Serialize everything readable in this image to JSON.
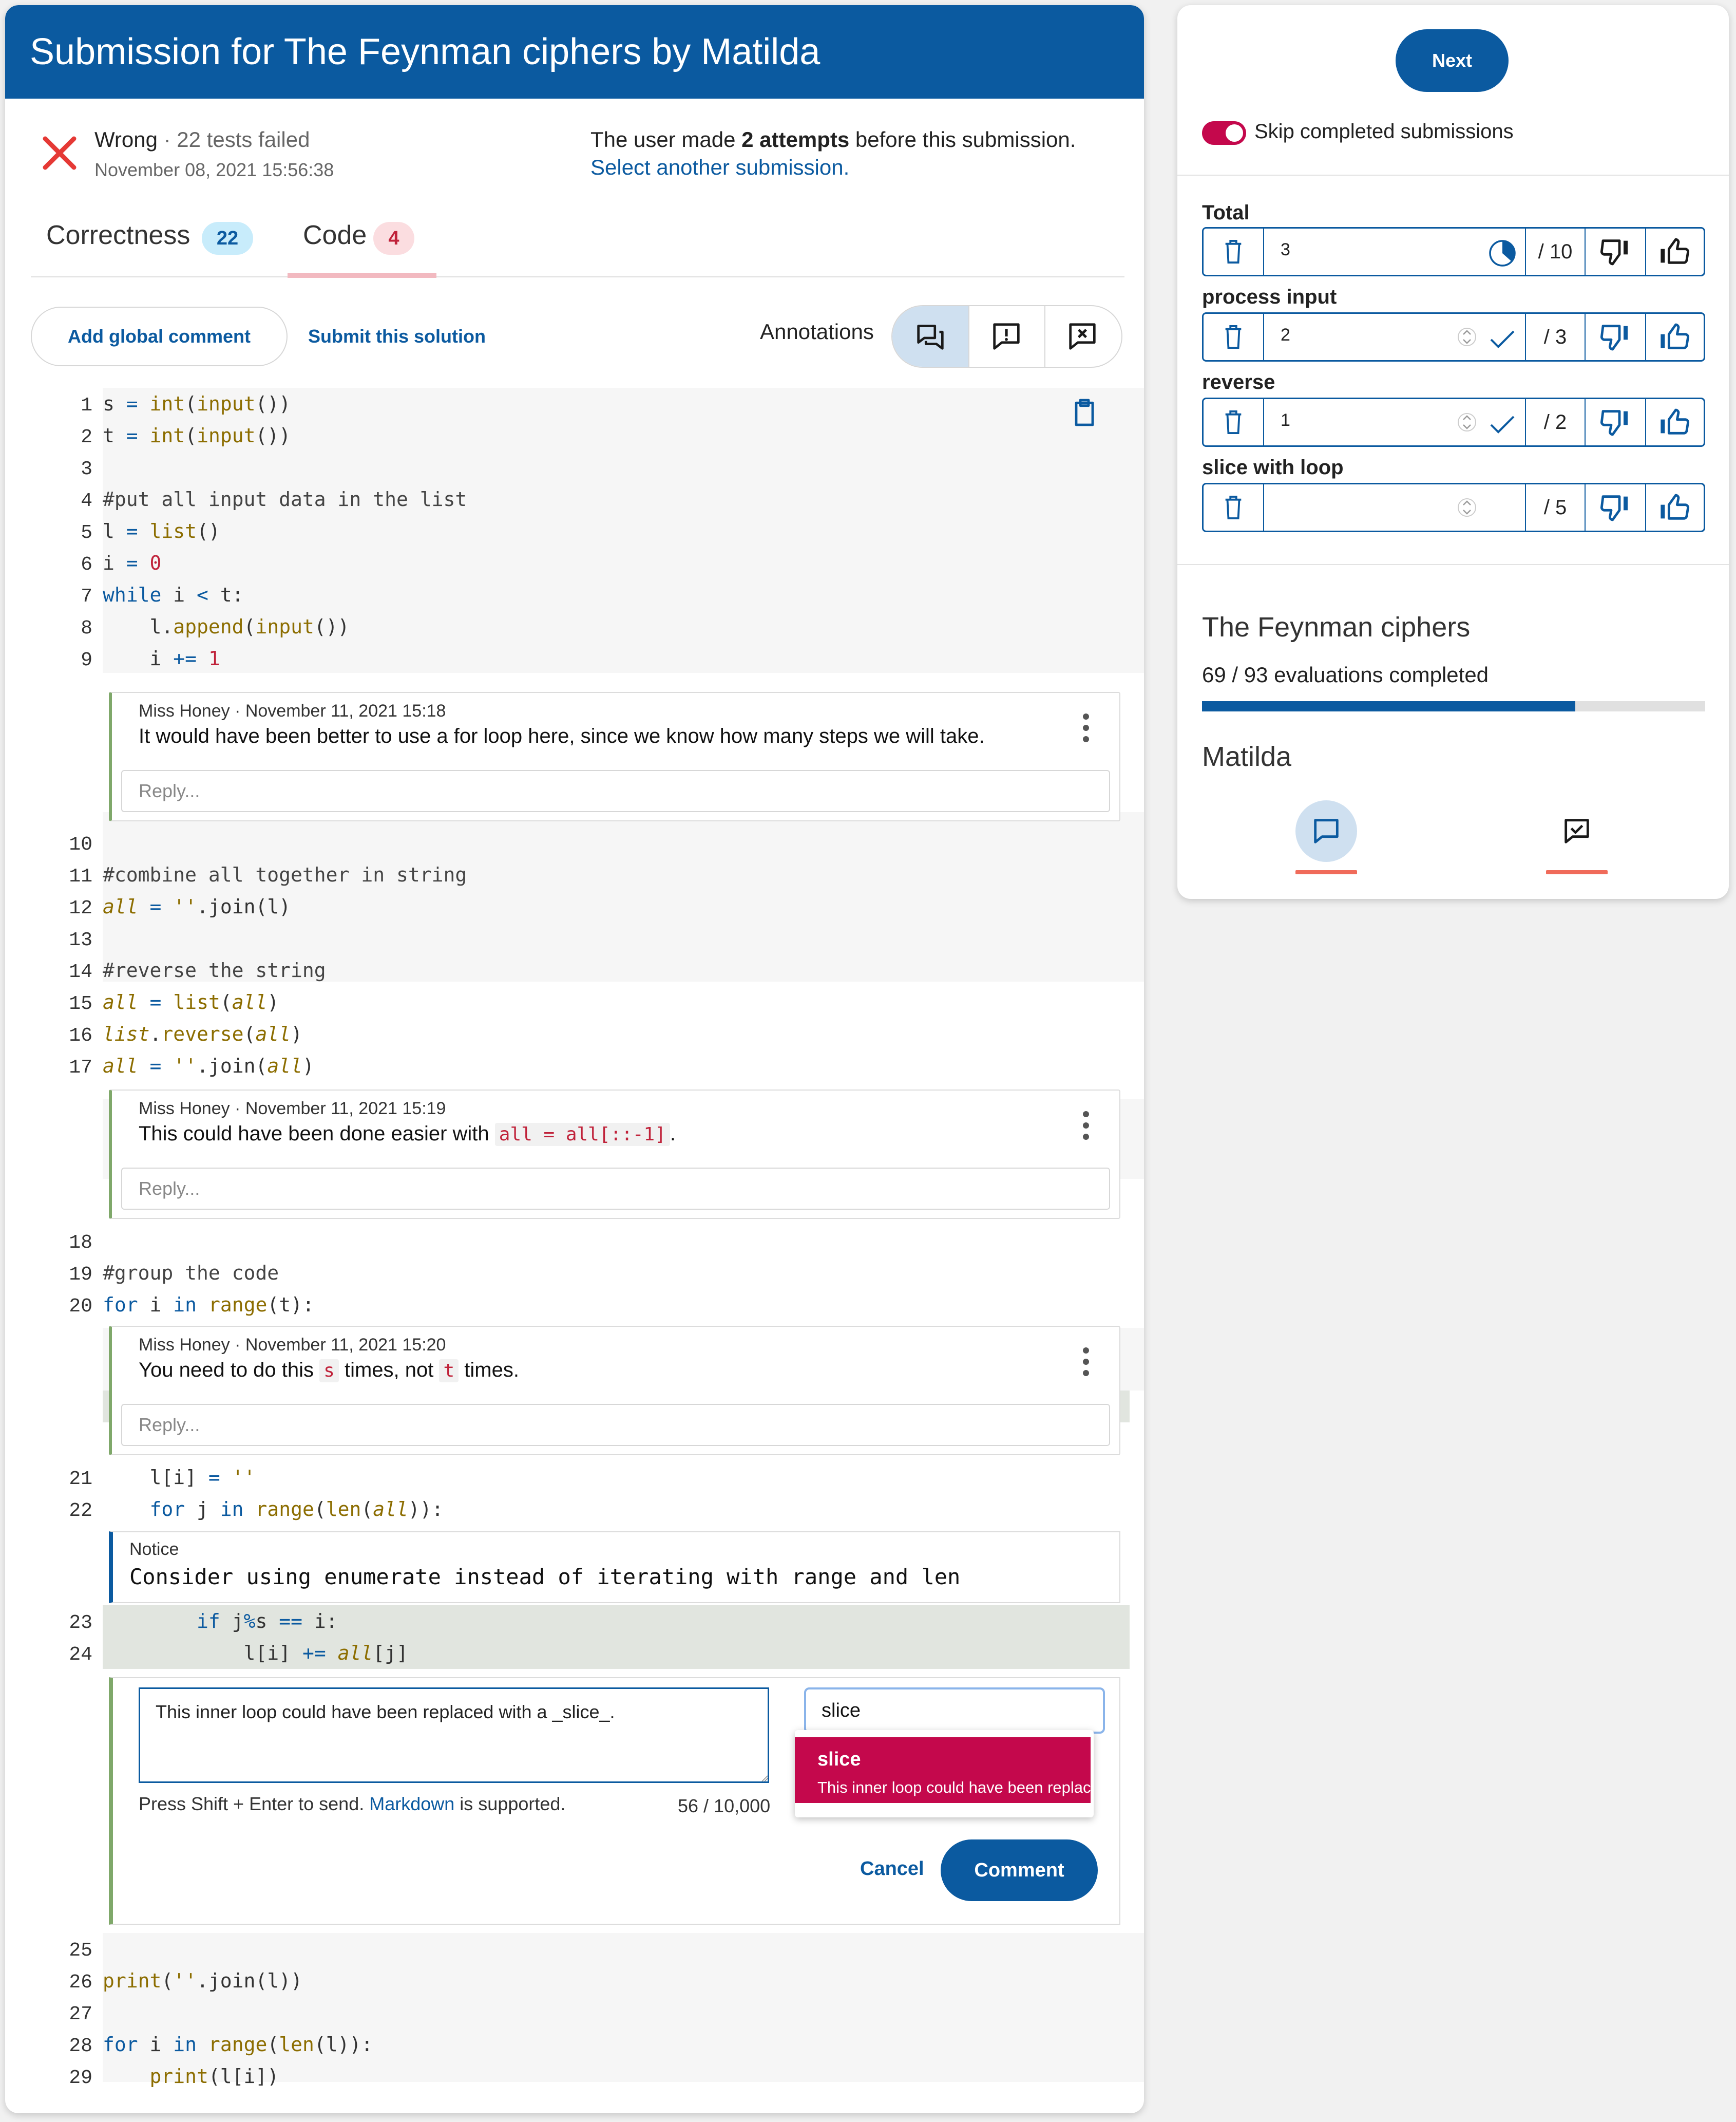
{
  "header": {
    "title": "Submission for The Feynman ciphers by Matilda"
  },
  "status": {
    "result": "Wrong",
    "separator": " · ",
    "tests": "22 tests failed",
    "date": "November 08, 2021 15:56:38",
    "attempts_prefix": "The user made ",
    "attempts_count": "2 attempts",
    "attempts_suffix": " before this submission.",
    "select_link": "Select another submission."
  },
  "tabs": [
    {
      "label": "Correctness",
      "badge": "22"
    },
    {
      "label": "Code",
      "badge": "4"
    }
  ],
  "toolbar": {
    "add_global": "Add global comment",
    "submit": "Submit this solution",
    "annotations_label": "Annotations"
  },
  "code": {
    "lines": [
      "s = int(input())",
      "t = int(input())",
      "",
      "#put all input data in the list",
      "l = list()",
      "i = 0",
      "while i < t:",
      "    l.append(input())",
      "    i += 1",
      "",
      "#combine all together in string",
      "all = ''.join(l)",
      "",
      "#reverse the string",
      "all = list(all)",
      "list.reverse(all)",
      "all = ''.join(all)",
      "",
      "#group the code",
      "for i in range(t):",
      "    l[i] = ''",
      "    for j in range(len(all)):",
      "        if j%s == i:",
      "            l[i] += all[j]",
      "",
      "print(''.join(l))",
      "",
      "for i in range(len(l)):",
      "    print(l[i])"
    ]
  },
  "comments": [
    {
      "meta": "Miss Honey · November 11, 2021 15:18",
      "text": "It would have been better to use a for loop here, since we know how many steps we will take.",
      "reply": "Reply..."
    },
    {
      "meta": "Miss Honey · November 11, 2021 15:19",
      "text_before": "This could have been done easier with ",
      "code": "all = all[::-1]",
      "text_after": ".",
      "reply": "Reply..."
    },
    {
      "meta": "Miss Honey · November 11, 2021 15:20",
      "text_1": "You need to do this ",
      "code_1": "s",
      "text_2": " times, not ",
      "code_2": "t",
      "text_3": " times.",
      "reply": "Reply..."
    }
  ],
  "notice": {
    "title": "Notice",
    "body": "Consider using enumerate instead of iterating with range and len"
  },
  "editor": {
    "text": "This inner loop could have been replaced with a _slice_.",
    "hint_prefix": "Press Shift + Enter to send. ",
    "hint_link": "Markdown",
    "hint_suffix": " is supported.",
    "count": "56 / 10,000",
    "snippet_value": "slice",
    "cancel": "Cancel",
    "comment": "Comment",
    "suggestion_title": "slice",
    "suggestion_text": "This inner loop could have been replaced with a _slice_."
  },
  "panel": {
    "next": "Next",
    "skip_label": "Skip completed submissions",
    "skip_on": true,
    "scores": [
      {
        "label": "Total",
        "value": "3",
        "max": "/ 10",
        "status": "clock"
      },
      {
        "label": "process input",
        "value": "2",
        "max": "/ 3",
        "status": "check"
      },
      {
        "label": "reverse",
        "value": "1",
        "max": "/ 2",
        "status": "check"
      },
      {
        "label": "slice with loop",
        "value": "",
        "max": "/ 5",
        "status": "none"
      }
    ],
    "exercise": "The Feynman ciphers",
    "progress_text": "69 / 93 evaluations completed",
    "progress_completed": 69,
    "progress_total": 93,
    "user": "Matilda"
  },
  "colors": {
    "brand": "#0b5aa0",
    "error": "#e53935",
    "accent": "#c4084c",
    "comment_border": "#7fa86a"
  }
}
